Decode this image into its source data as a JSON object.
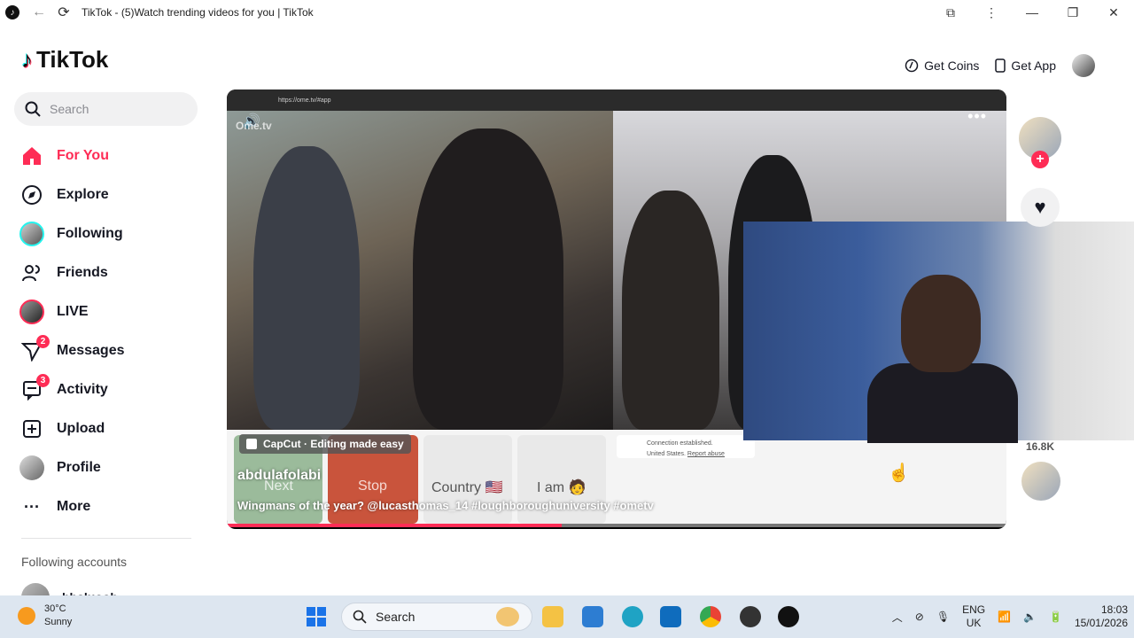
{
  "browser": {
    "title": "TikTok - (5)Watch trending videos for you | TikTok"
  },
  "brand": {
    "name": "TikTok"
  },
  "search": {
    "placeholder": "Search"
  },
  "nav": {
    "items": [
      {
        "label": "For You",
        "icon": "home-icon",
        "active": true
      },
      {
        "label": "Explore",
        "icon": "compass-icon"
      },
      {
        "label": "Following",
        "icon": "following-avatar-icon"
      },
      {
        "label": "Friends",
        "icon": "friends-icon"
      },
      {
        "label": "LIVE",
        "icon": "live-avatar-icon"
      },
      {
        "label": "Messages",
        "icon": "messages-icon",
        "badge": "2"
      },
      {
        "label": "Activity",
        "icon": "activity-icon",
        "badge": "3"
      },
      {
        "label": "Upload",
        "icon": "upload-icon"
      },
      {
        "label": "Profile",
        "icon": "profile-avatar-icon"
      },
      {
        "label": "More",
        "icon": "more-icon"
      }
    ]
  },
  "following_accounts": {
    "title": "Following accounts",
    "items": [
      {
        "name": "bbaluoob"
      }
    ]
  },
  "topbar": {
    "get_coins": "Get Coins",
    "get_app": "Get App"
  },
  "video": {
    "embedded_url": "https://ome.tv/#app",
    "watermark": "Ome.tv",
    "sponsor": "CapCut · Editing made easy",
    "author": "abdulafolabi",
    "caption": "Wingmans of the year? @lucasthomas_14 #loughboroughuniversity #ometv",
    "buttons": {
      "next": "Next",
      "stop": "Stop",
      "country": "Country 🇺🇸",
      "iam": "I am 🧑"
    },
    "connection_status": "Connection established.",
    "connection_country": "United States.",
    "report": "Report abuse",
    "progress": 0.43
  },
  "rail": {
    "share_count": "16.8K"
  },
  "taskbar": {
    "weather_temp": "30°C",
    "weather_desc": "Sunny",
    "search_label": "Search",
    "lang_top": "ENG",
    "lang_bottom": "UK",
    "time": "18:03",
    "date": "15/01/2026"
  },
  "colors": {
    "accent": "#fe2c55",
    "cyan": "#25f4ee"
  }
}
